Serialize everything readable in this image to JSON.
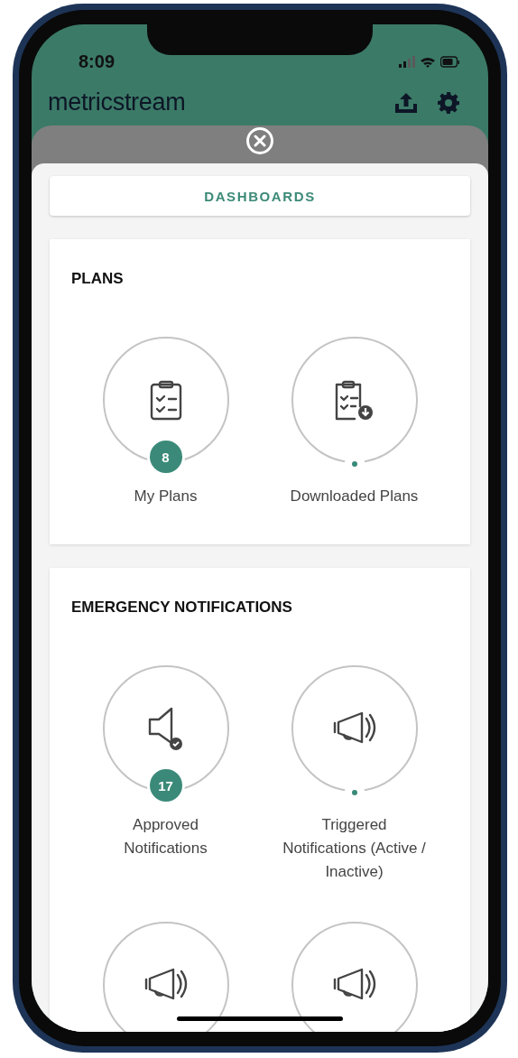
{
  "status_bar": {
    "time": "8:09"
  },
  "header": {
    "logo": "metricstream"
  },
  "tabs": [
    {
      "label": "DASHBOARDS",
      "selected": true
    }
  ],
  "sections": [
    {
      "title": "PLANS",
      "tiles": [
        {
          "kind": "clipboard",
          "label": "My Plans",
          "badge": "8"
        },
        {
          "kind": "clipboard-download",
          "label": "Downloaded Plans"
        }
      ]
    },
    {
      "title": "EMERGENCY NOTIFICATIONS",
      "tiles": [
        {
          "kind": "speaker-check",
          "label": "Approved Notifications",
          "badge": "17"
        },
        {
          "kind": "megaphone",
          "label": "Triggered Notifications (Active / Inactive)"
        },
        {
          "kind": "megaphone"
        },
        {
          "kind": "megaphone"
        }
      ]
    }
  ]
}
